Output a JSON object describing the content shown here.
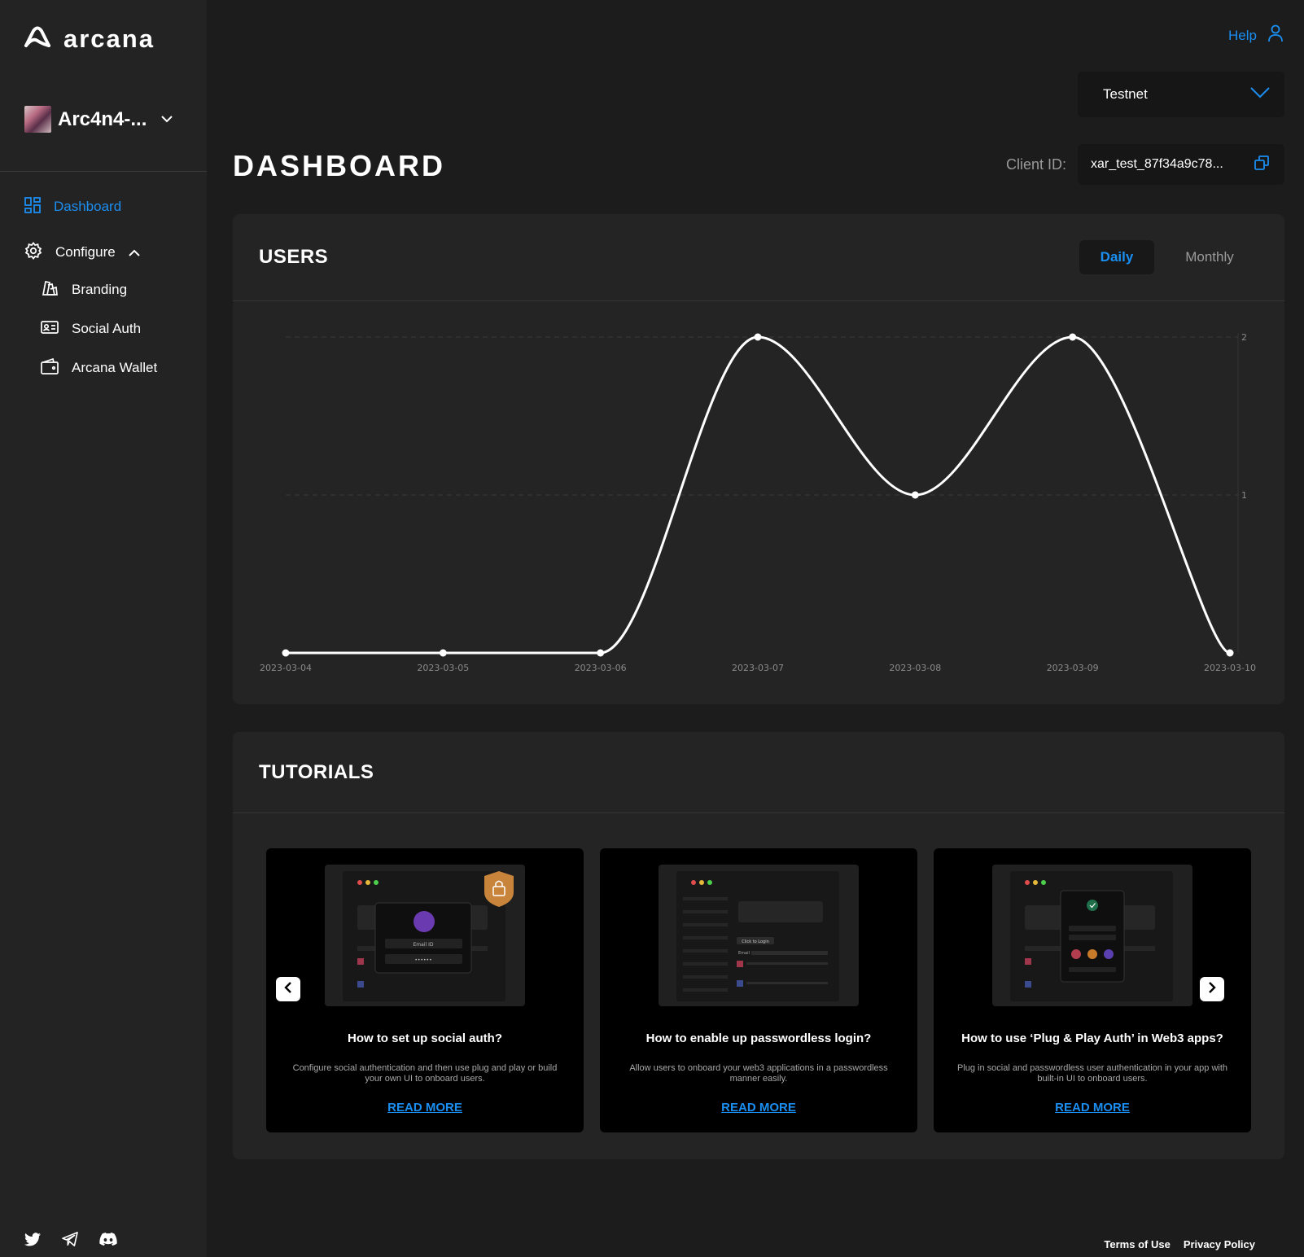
{
  "brand": {
    "name": "arcana"
  },
  "app": {
    "name": "Arc4n4-..."
  },
  "nav": {
    "dashboard": "Dashboard",
    "configure": "Configure",
    "branding": "Branding",
    "social_auth": "Social Auth",
    "arcana_wallet": "Arcana Wallet"
  },
  "header": {
    "help": "Help",
    "network": "Testnet",
    "page_title": "DASHBOARD",
    "client_label": "Client ID:",
    "client_id": "xar_test_87f34a9c78..."
  },
  "users": {
    "title": "USERS",
    "daily": "Daily",
    "monthly": "Monthly"
  },
  "chart_data": {
    "type": "line",
    "title": "",
    "xlabel": "",
    "ylabel": "",
    "categories": [
      "2023-03-04",
      "2023-03-05",
      "2023-03-06",
      "2023-03-07",
      "2023-03-08",
      "2023-03-09",
      "2023-03-10"
    ],
    "series": [
      {
        "values": [
          0,
          0,
          0,
          2,
          1,
          2,
          0
        ]
      }
    ],
    "yticks": [
      "1",
      "2"
    ],
    "ylim": [
      0,
      2
    ],
    "grid": true,
    "line_color": "#ffffff"
  },
  "tutorials": {
    "title": "TUTORIALS",
    "items": [
      {
        "title": "How to set up social auth?",
        "desc": "Configure social authentication and then use plug and play or build your own UI to onboard users.",
        "link": "READ MORE",
        "img_label1": "Email ID",
        "img_label2": "••••••"
      },
      {
        "title": "How to enable up passwordless login?",
        "desc": "Allow users to onboard your web3 applications in a passwordless manner easily.",
        "link": "READ MORE",
        "img_label1": "Click to Login",
        "img_label2": "Email"
      },
      {
        "title": "How to use ‘Plug & Play Auth’ in Web3 apps?",
        "desc": "Plug in social and passwordless user authentication in your app with built-in UI to onboard users.",
        "link": "READ MORE"
      }
    ]
  },
  "footer": {
    "terms": "Terms of Use",
    "privacy": "Privacy Policy"
  },
  "colors": {
    "accent": "#1b8ef2",
    "background": "#1c1c1c",
    "sidebar": "#232323",
    "card": "#242424"
  }
}
